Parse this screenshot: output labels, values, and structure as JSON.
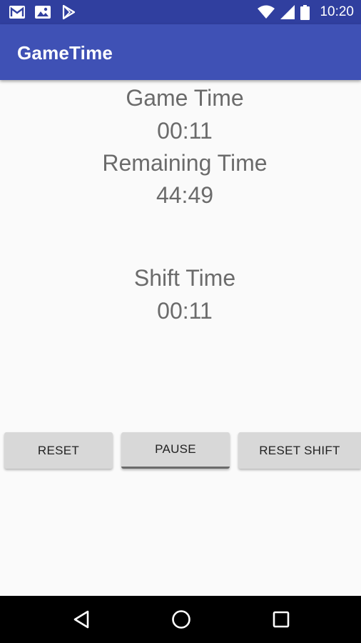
{
  "status_bar": {
    "time": "10:20",
    "left_icons": [
      "mail-icon",
      "gallery-icon",
      "play-store-icon"
    ],
    "right_icons": [
      "wifi-icon",
      "signal-icon",
      "battery-icon"
    ]
  },
  "app_bar": {
    "title": "GameTime",
    "color": "#3f51b5",
    "status_color": "#303f9f"
  },
  "timers": {
    "game_time_label": "Game Time",
    "game_time_value": "00:11",
    "remaining_time_label": "Remaining Time",
    "remaining_time_value": "44:49",
    "shift_time_label": "Shift Time",
    "shift_time_value": "00:11"
  },
  "buttons": {
    "reset": "RESET",
    "pause": "PAUSE",
    "reset_shift": "RESET SHIFT"
  },
  "nav_bar": {
    "icons": [
      "back-icon",
      "home-icon",
      "recents-icon"
    ]
  }
}
